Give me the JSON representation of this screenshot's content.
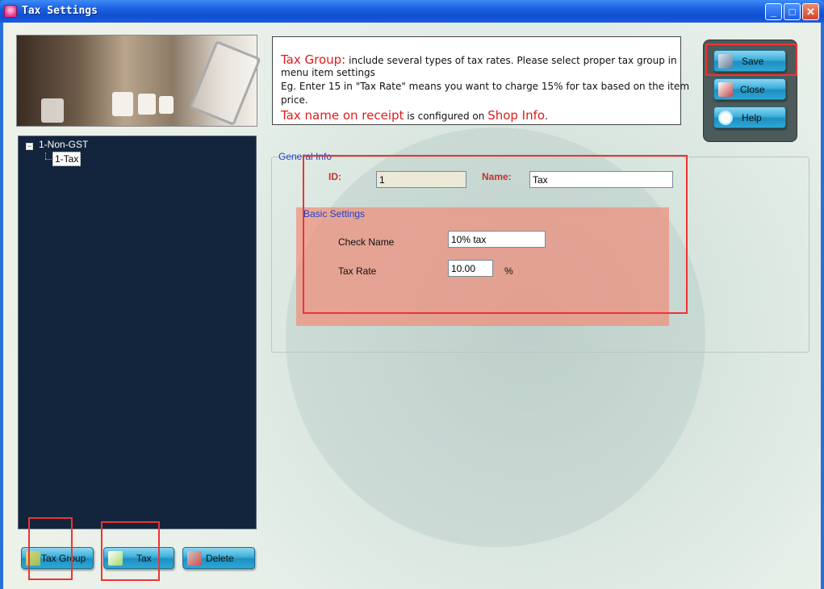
{
  "window": {
    "title": "Tax Settings",
    "controls": {
      "minimize": "_",
      "maximize": "□",
      "close": "✕"
    }
  },
  "info": {
    "line1_highlight": "Tax Group:",
    "line1_rest": " include several types of tax rates. Please select proper tax group in",
    "line2": "menu item settings",
    "line3": "Eg. Enter 15 in \"Tax Rate\" means you want to charge 15% for tax based on the item",
    "line4": "price.",
    "line5_highlight": "Tax name on receipt",
    "line5_mid": " is configured on ",
    "line5_link": "Shop Info",
    "line5_end": "."
  },
  "toolbar": {
    "save_label": "Save",
    "close_label": "Close",
    "help_label": "Help"
  },
  "tree": {
    "root_label": "1-Non-GST",
    "child_label": "1-Tax",
    "expander": "−"
  },
  "bottom_buttons": {
    "tax_group_label": "Tax Group",
    "tax_label": "Tax",
    "delete_label": "Delete"
  },
  "general_info": {
    "legend": "General Info",
    "id_label": "ID:",
    "id_value": "1",
    "name_label": "Name:",
    "name_value": "Tax"
  },
  "basic_settings": {
    "legend": "Basic Settings",
    "check_name_label": "Check Name",
    "check_name_value": "10% tax",
    "tax_rate_label": "Tax Rate",
    "tax_rate_value": "10.00",
    "tax_rate_unit": "%"
  },
  "colors": {
    "title_bar": "#1b5fe0",
    "tree_bg": "#13243d",
    "highlight_red": "#e33333",
    "button_blue": "#3ab0dc",
    "basic_settings_bg": "#f08c78"
  },
  "icons": {
    "app": "app-icon",
    "save": "floppy-disk-icon",
    "close": "exit-door-icon",
    "help": "heart-icon",
    "tax_group": "add-folder-icon",
    "tax": "add-document-icon",
    "delete": "trash-icon"
  }
}
